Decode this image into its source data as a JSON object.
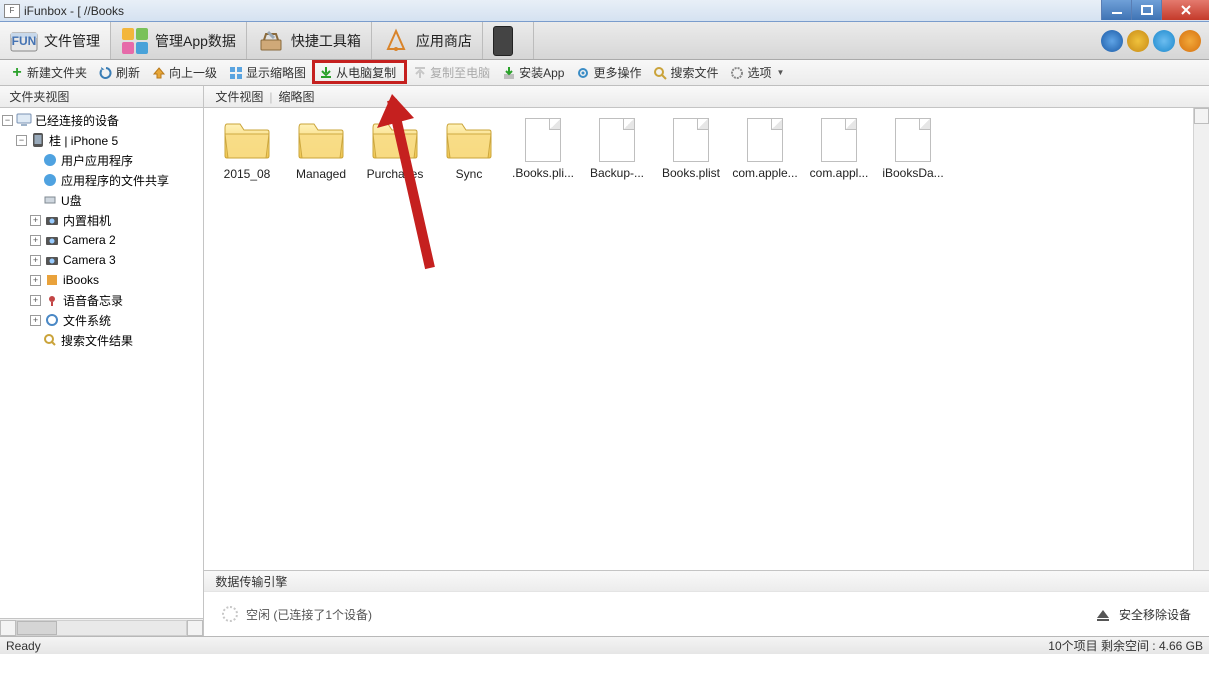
{
  "titlebar": {
    "text": "iFunbox - [             //Books"
  },
  "maintabs": {
    "file_manager": "文件管理",
    "app_data": "管理App数据",
    "toolbox": "快捷工具箱",
    "app_store": "应用商店",
    "device_text": "­­­­­­­­­­­"
  },
  "toolbar": {
    "new_folder": "新建文件夹",
    "refresh": "刷新",
    "up": "向上一级",
    "thumbs": "显示缩略图",
    "copy_from_pc": "从电脑复制",
    "copy_to_pc": "复制至电脑",
    "install_app": "安装App",
    "more": "更多操作",
    "search": "搜索文件",
    "options": "选项"
  },
  "sidebar": {
    "header": "文件夹视图",
    "root": "已经连接的设备",
    "device_row": "桂             | iPhone 5",
    "items": {
      "user_apps": "用户应用程序",
      "app_file_sharing": "应用程序的文件共享",
      "usb": "U盘",
      "camera": "内置相机",
      "camera2": "Camera 2",
      "camera3": "Camera 3",
      "ibooks": "iBooks",
      "voice": "语音备忘录",
      "filesystem": "文件系统",
      "search_results": "搜索文件结果"
    }
  },
  "viewbar": {
    "file_view": "文件视图",
    "thumb_view": "缩略图"
  },
  "files": [
    {
      "type": "folder",
      "name": "2015_08"
    },
    {
      "type": "folder",
      "name": "Managed"
    },
    {
      "type": "folder",
      "name": "Purchases"
    },
    {
      "type": "folder",
      "name": "Sync"
    },
    {
      "type": "file",
      "name": ".Books.pli..."
    },
    {
      "type": "file",
      "name": "Backup-..."
    },
    {
      "type": "file",
      "name": "Books.plist"
    },
    {
      "type": "file",
      "name": "com.apple..."
    },
    {
      "type": "file",
      "name": "com.appl..."
    },
    {
      "type": "file",
      "name": "iBooksDa..."
    }
  ],
  "transfer": {
    "header": "数据传输引擎",
    "idle": "空闲 (已连接了1个设备)",
    "eject": "安全移除设备"
  },
  "statusbar": {
    "ready": "Ready",
    "right": "10个项目 剩余空间 : 4.66 GB"
  }
}
